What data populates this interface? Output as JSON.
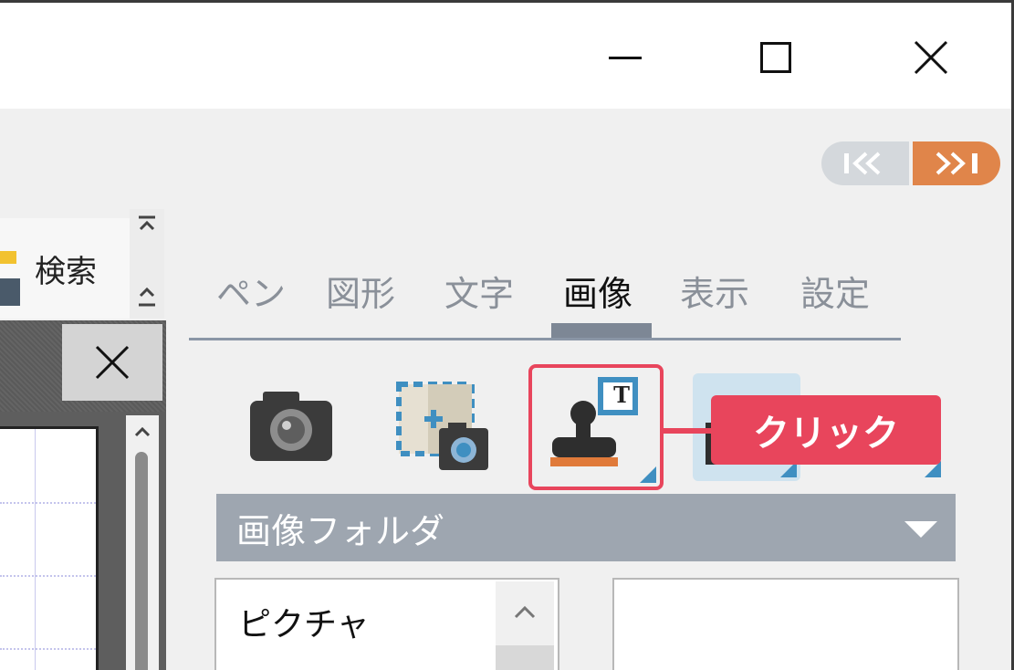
{
  "window": {
    "controls": {
      "minimize": "minimize",
      "maximize": "maximize",
      "close": "close"
    }
  },
  "pager": {
    "first_icon": "rewind-icon",
    "last_icon": "fast-forward-icon"
  },
  "left": {
    "search_label": "検索"
  },
  "tabs": [
    {
      "label": "ペン",
      "active": false
    },
    {
      "label": "図形",
      "active": false
    },
    {
      "label": "文字",
      "active": false
    },
    {
      "label": "画像",
      "active": true
    },
    {
      "label": "表示",
      "active": false
    },
    {
      "label": "設定",
      "active": false
    }
  ],
  "tools": {
    "camera_icon": "camera-icon",
    "capture_icon": "screen-capture-icon",
    "stamp_icon": "stamp-icon",
    "stamp_badge": "T"
  },
  "callout": {
    "text": "クリック"
  },
  "folder": {
    "label": "画像フォルダ"
  },
  "folder_list": {
    "items": [
      "ピクチャ"
    ]
  },
  "colors": {
    "accent": "#e8455c",
    "orange": "#e0854a",
    "folder_bar": "#9ea6b0",
    "selection": "#cfe3ef"
  }
}
